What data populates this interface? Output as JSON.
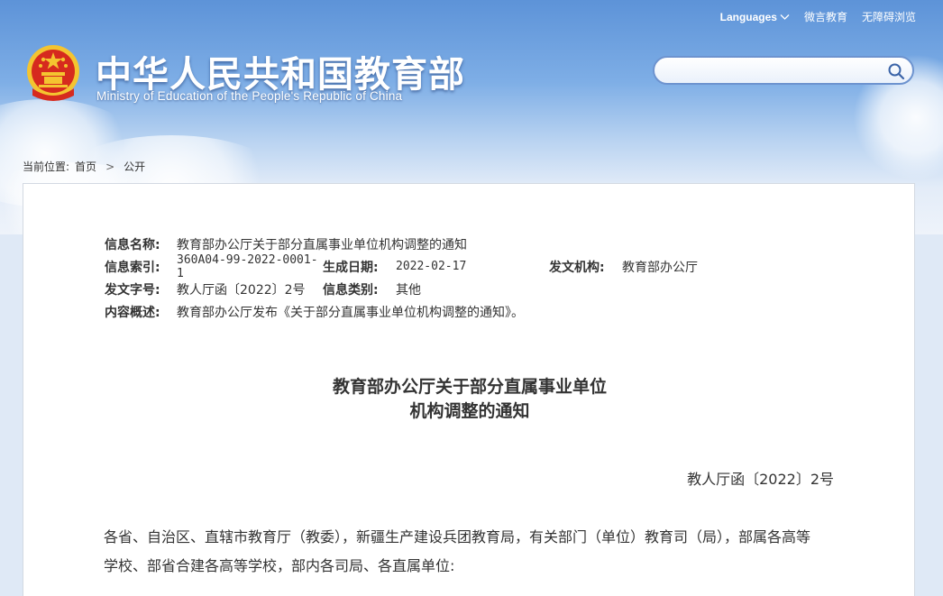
{
  "header": {
    "site_title": "中华人民共和国教育部",
    "site_subtitle": "Ministry of Education of the People's Republic of China",
    "top_links": {
      "languages": "Languages",
      "weibo": "微言教育",
      "accessibility": "无障碍浏览"
    },
    "search": {
      "placeholder": "",
      "value": ""
    }
  },
  "breadcrumb": {
    "prefix": "当前位置:",
    "home": "首页",
    "separator": ">",
    "current": "公开"
  },
  "meta": {
    "name_label": "信息名称:",
    "name_value": "教育部办公厅关于部分直属事业单位机构调整的通知",
    "index_label": "信息索引:",
    "index_value": "360A04-99-2022-0001-1",
    "date_label": "生成日期:",
    "date_value": "2022-02-17",
    "org_label": "发文机构:",
    "org_value": "教育部办公厅",
    "docno_label": "发文字号:",
    "docno_value": "教人厅函〔2022〕2号",
    "category_label": "信息类别:",
    "category_value": "其他",
    "summary_label": "内容概述:",
    "summary_value": "教育部办公厅发布《关于部分直属事业单位机构调整的通知》。"
  },
  "document": {
    "title_line1": "教育部办公厅关于部分直属事业单位",
    "title_line2": "机构调整的通知",
    "number": "教人厅函〔2022〕2号",
    "body_line1": "各省、自治区、直辖市教育厅（教委），新疆生产建设兵团教育局，有关部门（单位）教育司（局），部属各高等",
    "body_line2": "学校、部省合建各高等学校，部内各司局、各直属单位:"
  },
  "colors": {
    "banner_top": "#5d93d8",
    "emblem_red": "#d62a1e",
    "emblem_gold": "#f4c430",
    "search_border": "#6d93cf",
    "page_bg": "#dfe9f6"
  }
}
